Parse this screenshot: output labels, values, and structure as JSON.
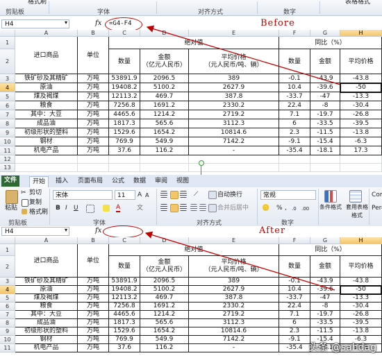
{
  "top_ribbon_groups": [
    "剪贴板",
    "字体",
    "对齐方式",
    "数字"
  ],
  "top_ribbon_extras": {
    "format_painter": "格式刷",
    "table_format": "表格格式"
  },
  "top_formula": {
    "cell": "H4",
    "fx": "fx",
    "value": "=G4-F4"
  },
  "before_label": "Before",
  "after_label": "After",
  "tabs": [
    "文件",
    "开始",
    "插入",
    "页面布局",
    "公式",
    "数据",
    "审阅",
    "视图"
  ],
  "ribbon": {
    "cut": "剪切",
    "copy": "复制",
    "paste": "粘贴",
    "format_painter": "格式刷",
    "font_name": "宋体",
    "font_size": "11",
    "wrap": "自动换行",
    "merge": "合并后居中",
    "number_format": "常规",
    "cond_format": "条件格式",
    "table_format": "套用表格格式",
    "extra1": "Com",
    "extra2": "Perc",
    "groups": [
      "剪贴板",
      "字体",
      "对齐方式",
      "数字"
    ]
  },
  "bottom_formula": {
    "cell": "H4",
    "fx": "fx",
    "value": ""
  },
  "columns": [
    "A",
    "B",
    "C",
    "D",
    "E",
    "F",
    "G",
    "H"
  ],
  "table": {
    "header": {
      "product": "进口商品",
      "unit": "单位",
      "absolute": "绝对值",
      "yoy": "同比（%）",
      "qty": "数量",
      "amount": "金额",
      "amount_unit": "（亿元人民币）",
      "avg_price": "平均价格",
      "avg_price_unit": "（元人民币/吨、辆）",
      "yoy_qty": "数量",
      "yoy_amount": "金额",
      "yoy_price": "平均价格"
    },
    "rows": [
      [
        "铁矿砂及其精矿",
        "万吨",
        "53891.9",
        "2096.5",
        "389",
        "-0.1",
        "-43.9",
        "-43.8"
      ],
      [
        "原油",
        "万吨",
        "19408.2",
        "5100.2",
        "2627.9",
        "10.4",
        "-39.6",
        "-50"
      ],
      [
        "煤及褐煤",
        "万吨",
        "12113.2",
        "469.7",
        "387.8",
        "-33.7",
        "-47",
        "-13.3"
      ],
      [
        "粮食",
        "万吨",
        "7256.8",
        "1691.2",
        "2330.2",
        "22.4",
        "-8",
        "-30.4"
      ],
      [
        "其中：大豆",
        "万吨",
        "4465.6",
        "1214.2",
        "2719.2",
        "7.1",
        "-19.7",
        "-26.8"
      ],
      [
        "成品油",
        "万吨",
        "1817.3",
        "565.6",
        "3112.3",
        "6",
        "-33.5",
        "-39.5"
      ],
      [
        "初级形状的塑料",
        "万吨",
        "1529.6",
        "1654.2",
        "10814.6",
        "2.3",
        "-11.5",
        "-13.8"
      ],
      [
        "钢材",
        "万吨",
        "769.9",
        "549.9",
        "7142.2",
        "-9.1",
        "-15.4",
        "-6.3"
      ],
      [
        "机电产品",
        "万吨",
        "37.6",
        "116.2",
        "-",
        "-35.4",
        "-18.1",
        "17.3"
      ]
    ]
  },
  "watermark": "头条 @sahdag",
  "colors": {
    "annotation": "#c40000",
    "file_tab": "#2f6a34",
    "selected_header": "#f5c56a"
  }
}
